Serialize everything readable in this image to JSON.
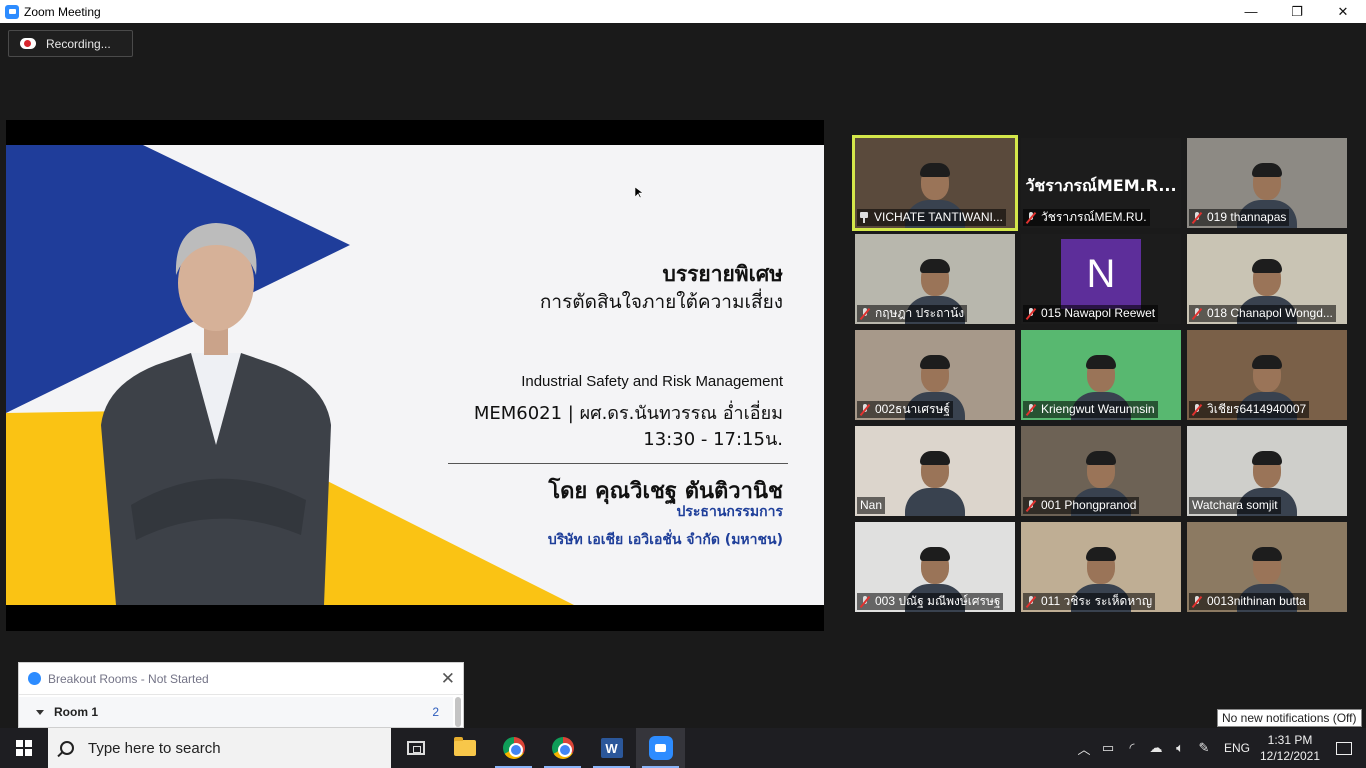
{
  "window": {
    "title": "Zoom Meeting",
    "controls": [
      "—",
      "❐",
      "✕"
    ]
  },
  "recording": {
    "label": "Recording..."
  },
  "slide": {
    "heading": "บรรยายพิเศษ",
    "subheading": "การตัดสินใจภายใต้ความเสี่ยง",
    "course": "Industrial Safety and Risk Management",
    "course_code": "MEM6021 | ผศ.ดร.นันทวรรณ อ่ำเอี่ยม",
    "time": "13:30 - 17:15น.",
    "speaker": "โดย คุณวิเชฐ ตันติวานิช",
    "position": "ประธานกรรมการ",
    "company": "บริษัท เอเชีย เอวิเอชั่น จำกัด (มหาชน)"
  },
  "gallery": [
    {
      "name": "VICHATE TANTIWANI...",
      "icon": "pin",
      "active": true,
      "bg": "#5a4a3c"
    },
    {
      "name": "วัชราภรณ์MEM.RU.",
      "icon": "mic-muted",
      "display_name": "วัชราภรณ์MEM.R...",
      "bg": "#1c1c1c"
    },
    {
      "name": "019 thannapas",
      "icon": "mic-muted",
      "bg": "#8d8a84"
    },
    {
      "name": "กฤษฎา ประถาน้ง",
      "icon": "mic-muted",
      "bg": "#b8b7ad"
    },
    {
      "name": "015 Nawapol Reewet",
      "icon": "mic-muted",
      "avatar": "N",
      "bg": "#1c1c1c"
    },
    {
      "name": "018 Chanapol Wongd...",
      "icon": "mic-muted",
      "bg": "#c9c4b4"
    },
    {
      "name": "002ธนาเศรษฐ์",
      "icon": "mic-muted",
      "bg": "#a7998a"
    },
    {
      "name": "Kriengwut Warunnsin",
      "icon": "mic-muted",
      "bg": "#58b870"
    },
    {
      "name": "วิเชียร6414940007",
      "icon": "mic-muted",
      "bg": "#7a6048"
    },
    {
      "name": "Nan",
      "icon": "none",
      "bg": "#dcd5cc"
    },
    {
      "name": "001 Phongpranod",
      "icon": "mic-muted",
      "bg": "#6d6255"
    },
    {
      "name": "Watchara somjit",
      "icon": "none",
      "bg": "#cfcfcb"
    },
    {
      "name": "003 ปณัฐ มณีพงษ์เศรษฐ",
      "icon": "mic-muted",
      "bg": "#e0e0df"
    },
    {
      "name": "011 วชิระ ระเห็ดหาญ",
      "icon": "mic-muted",
      "bg": "#bfae94"
    },
    {
      "name": "0013nithinan butta",
      "icon": "mic-muted",
      "bg": "#8c7a62"
    }
  ],
  "breakout": {
    "title": "Breakout Rooms - Not Started",
    "room_name": "Room 1",
    "room_count": "2"
  },
  "toast": "No new notifications (Off)",
  "taskbar": {
    "search_placeholder": "Type here to search",
    "apps": [
      "task-view",
      "file-explorer",
      "chrome",
      "chrome",
      "word",
      "zoom"
    ],
    "tray": {
      "language": "ENG",
      "time": "1:31 PM",
      "date": "12/12/2021"
    }
  }
}
